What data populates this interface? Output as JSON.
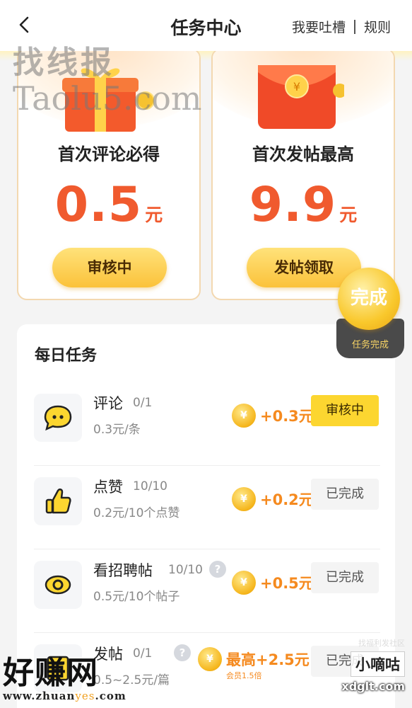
{
  "header": {
    "title": "任务中心",
    "feedback_link": "我要吐槽",
    "rules_link": "规则"
  },
  "watermarks": {
    "top_line1": "找线报",
    "top_line2": "Taolu5.com",
    "bottom_left_big": "好赚网",
    "bottom_left_url_a": "www.zhuan",
    "bottom_left_url_b": "yes",
    "bottom_left_url_c": ".com",
    "bottom_right_small": "找福利发社区",
    "bottom_right_box": "小嘀咕",
    "bottom_right_site": "xdglt.com"
  },
  "cards": [
    {
      "title": "首次评论必得",
      "amount": "0.5",
      "unit": "元",
      "button": "审核中"
    },
    {
      "title": "首次发帖最高",
      "amount": "9.9",
      "unit": "元",
      "button": "发帖领取"
    }
  ],
  "completion_badge": {
    "circle_text": "完成",
    "label": "任务完成"
  },
  "daily": {
    "title": "每日任务",
    "tasks": [
      {
        "name": "评论",
        "progress": "0/1",
        "desc": "0.3元/条",
        "reward": "+0.3元",
        "button": "审核中",
        "icon": "chat-bubble-icon",
        "status": "pending"
      },
      {
        "name": "点赞",
        "progress": "10/10",
        "desc": "0.2元/10个点赞",
        "reward": "+0.2元",
        "button": "已完成",
        "icon": "thumbs-up-icon",
        "status": "finished"
      },
      {
        "name": "看招聘帖",
        "progress": "10/10",
        "desc": "0.5元/10个帖子",
        "reward": "+0.5元",
        "button": "已完成",
        "icon": "eye-icon",
        "status": "finished"
      },
      {
        "name": "发帖",
        "progress": "0/1",
        "desc": "0.5~2.5元/篇",
        "reward": "最高+2.5元",
        "reward_note": "会员1.5倍",
        "button": "已完成",
        "icon": "post-icon",
        "status": "finished"
      }
    ]
  },
  "colors": {
    "accent_orange": "#f05a2e",
    "button_yellow": "#fcd630",
    "reward_orange": "#f58a1f"
  }
}
